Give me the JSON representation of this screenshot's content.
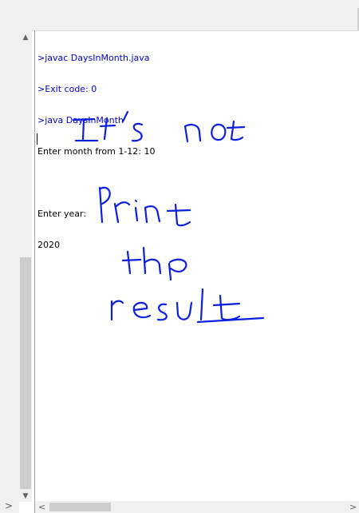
{
  "console": {
    "lines": [
      {
        "text": ">javac DaysInMonth.java",
        "kind": "cmd"
      },
      {
        "text": ">Exit code: 0",
        "kind": "cmd"
      },
      {
        "text": ">java DaysInMonth",
        "kind": "cmd"
      },
      {
        "text": "Enter month from 1-12: 10",
        "kind": "out"
      },
      {
        "text": "",
        "kind": "out"
      },
      {
        "text": "Enter year:",
        "kind": "out"
      },
      {
        "text": "2020",
        "kind": "out"
      }
    ]
  },
  "handwritten_note": {
    "lines": [
      "It's not",
      "Print",
      "the",
      "result"
    ]
  },
  "scrollbars": {
    "up_arrow": "▲",
    "down_arrow": "▼",
    "left_arrow": "<",
    "right_arrow": ">",
    "gutter_arrow": ">"
  },
  "colors": {
    "command_text": "#0000cc",
    "output_text": "#000000",
    "annotation_ink": "#0a1fe0"
  }
}
